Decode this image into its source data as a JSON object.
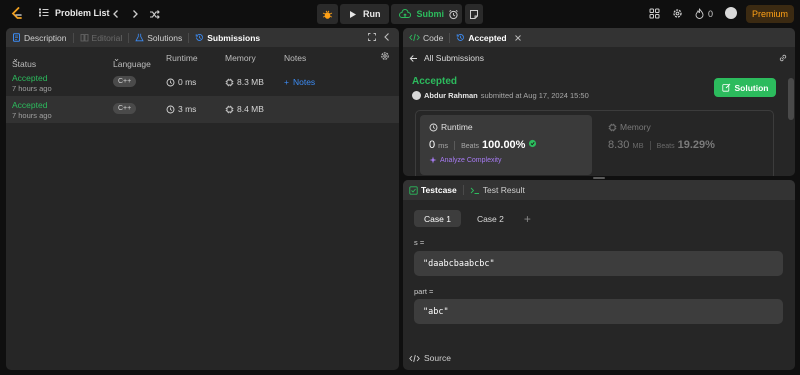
{
  "topbar": {
    "problem_list_label": "Problem List",
    "run_label": "Run",
    "submit_label": "Submit",
    "streak_count": "0",
    "premium_label": "Premium",
    "accent": "#ffa116"
  },
  "left_tabs": {
    "description": "Description",
    "editorial": "Editorial",
    "solutions": "Solutions",
    "submissions": "Submissions"
  },
  "table": {
    "headers": {
      "status": "Status",
      "language": "Language",
      "runtime": "Runtime",
      "memory": "Memory",
      "notes": "Notes"
    },
    "rows": [
      {
        "status": "Accepted",
        "ago": "7 hours ago",
        "language": "C++",
        "runtime": "0 ms",
        "memory": "8.3 MB",
        "notes": "Notes"
      },
      {
        "status": "Accepted",
        "ago": "7 hours ago",
        "language": "C++",
        "runtime": "3 ms",
        "memory": "8.4 MB",
        "notes": ""
      }
    ]
  },
  "right_tabs": {
    "code": "Code",
    "accepted": "Accepted"
  },
  "submission": {
    "all_submissions": "All Submissions",
    "status_title": "Accepted",
    "author": "Abdur Rahman",
    "submitted_text": "submitted at Aug 17, 2024 15:50",
    "solution_button": "Solution",
    "runtime_label": "Runtime",
    "runtime_value": "0",
    "runtime_unit": "ms",
    "runtime_beats_label": "Beats",
    "runtime_beats": "100.00%",
    "analyze": "Analyze Complexity",
    "memory_label": "Memory",
    "memory_value": "8.30",
    "memory_unit": "MB",
    "memory_beats_label": "Beats",
    "memory_beats": "19.29%",
    "status_color": "#2cbb5d"
  },
  "bottom_tabs": {
    "testcase": "Testcase",
    "test_result": "Test Result"
  },
  "testcase": {
    "case1": "Case 1",
    "case2": "Case 2",
    "add": "+",
    "param_s_label": "s =",
    "param_s_value": "\"daabcbaabcbc\"",
    "param_part_label": "part =",
    "param_part_value": "\"abc\"",
    "source_label": "Source"
  }
}
